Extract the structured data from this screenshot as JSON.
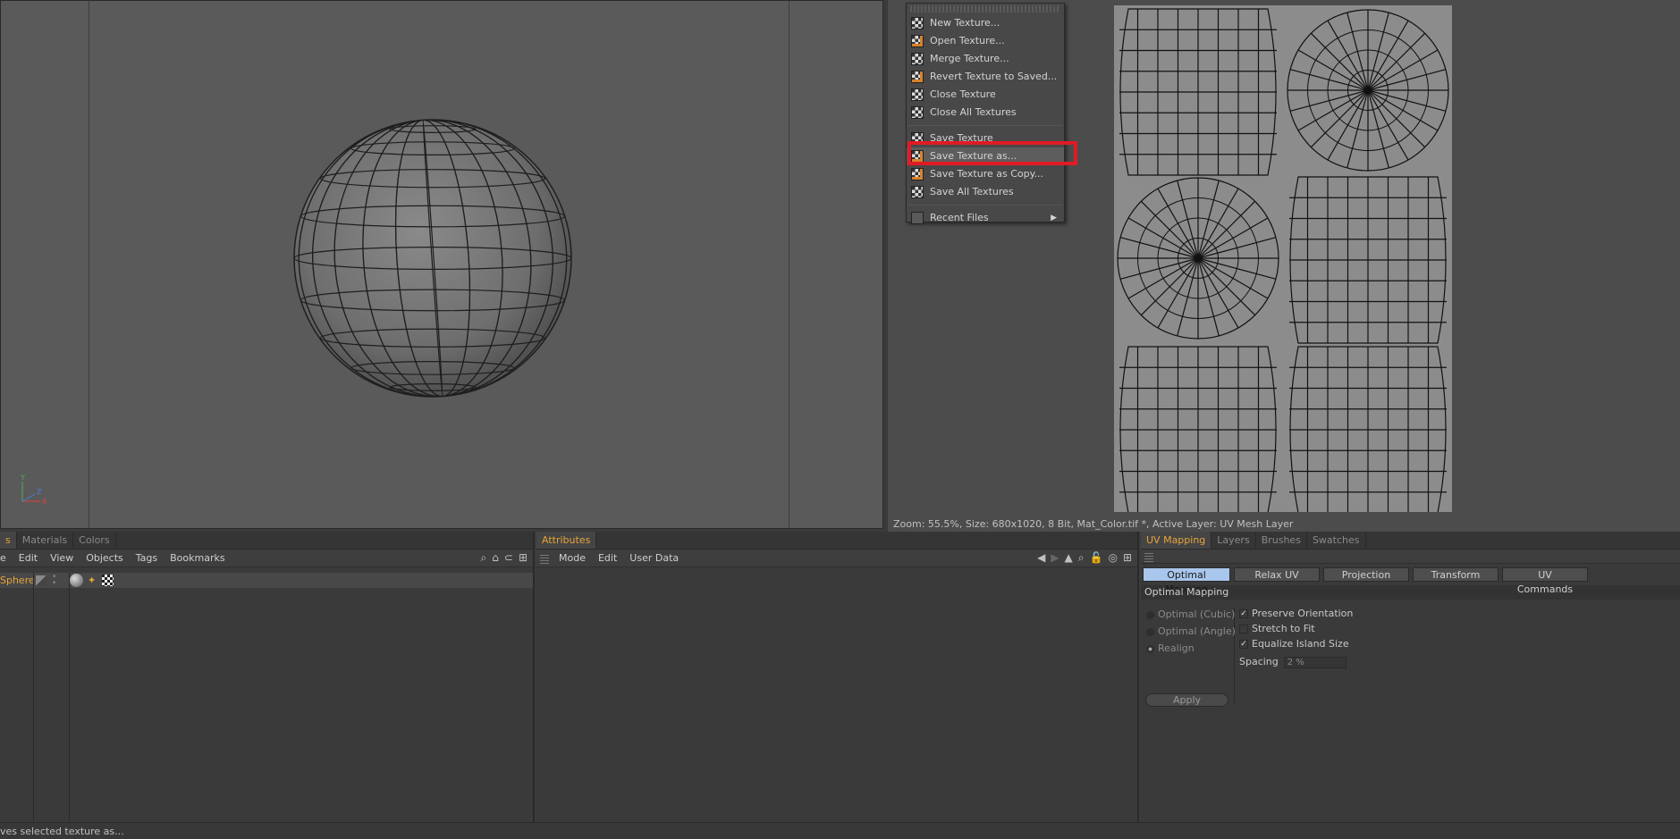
{
  "uv_editor": {
    "status": "Zoom: 55.5%, Size: 680x1020, 8 Bit, Mat_Color.tif *, Active Layer: UV Mesh Layer"
  },
  "file_menu": {
    "items": [
      {
        "label": "New Texture..."
      },
      {
        "label": "Open Texture..."
      },
      {
        "label": "Merge Texture..."
      },
      {
        "label": "Revert Texture to Saved..."
      },
      {
        "label": "Close Texture"
      },
      {
        "label": "Close All Textures"
      },
      {
        "label": "Save Texture"
      },
      {
        "label": "Save Texture as...",
        "selected": true
      },
      {
        "label": "Save Texture as Copy..."
      },
      {
        "label": "Save All Textures"
      },
      {
        "label": "Recent Files"
      }
    ]
  },
  "objects_panel": {
    "tabs": [
      "s",
      "Materials",
      "Colors"
    ],
    "menu": [
      "e",
      "Edit",
      "View",
      "Objects",
      "Tags",
      "Bookmarks"
    ],
    "object_name": "Sphere"
  },
  "attributes_panel": {
    "tab": "Attributes",
    "menu": [
      "Mode",
      "Edit",
      "User Data"
    ]
  },
  "uv_panel": {
    "tabs": [
      "UV Mapping",
      "Layers",
      "Brushes",
      "Swatches"
    ],
    "subtabs": [
      "Optimal Mapping",
      "Relax UV",
      "Projection",
      "Transform",
      "UV Commands"
    ],
    "section_title": "Optimal Mapping",
    "radios": [
      "Optimal (Cubic)",
      "Optimal (Angle)",
      "Realign"
    ],
    "checks": [
      {
        "label": "Preserve Orientation",
        "checked": true
      },
      {
        "label": "Stretch to Fit",
        "checked": false
      },
      {
        "label": "Equalize Island Size",
        "checked": true
      }
    ],
    "spacing_label": "Spacing",
    "spacing_value": "2 %",
    "apply_label": "Apply"
  },
  "status_bar": {
    "text": "ves selected texture as..."
  },
  "colors": {
    "accent": "#e8a43a",
    "highlight_box": "#e01b24",
    "active_subtab": "#a9c6ec"
  }
}
